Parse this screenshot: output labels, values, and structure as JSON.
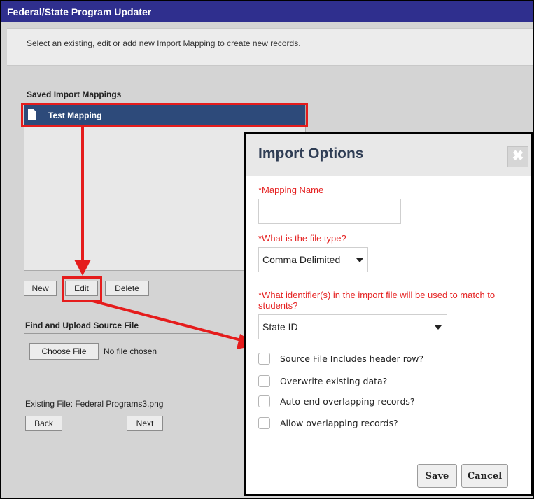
{
  "window": {
    "title": "Federal/State Program Updater"
  },
  "instructions": "Select an existing, edit or add new Import Mapping to create new records.",
  "saved_mappings": {
    "label": "Saved Import Mappings",
    "items": [
      {
        "label": "Test Mapping",
        "icon": "document-icon",
        "selected": true
      }
    ]
  },
  "mapping_buttons": {
    "new": "New",
    "edit": "Edit",
    "delete": "Delete"
  },
  "upload": {
    "label": "Find and Upload Source File",
    "choose_button": "Choose File",
    "status": "No file chosen",
    "existing_file": "Existing File: Federal Programs3.png"
  },
  "nav_buttons": {
    "back": "Back",
    "next": "Next"
  },
  "dialog": {
    "title": "Import Options",
    "close_glyph": "✖",
    "mapping_name_label": "*Mapping Name",
    "mapping_name_value": "",
    "file_type_label": "*What is the file type?",
    "file_type_value": "Comma Delimited",
    "identifier_label": "*What identifier(s) in the import file will be used to match to students?",
    "identifier_value": "State ID",
    "options": [
      {
        "label": "Source File Includes header row?",
        "checked": false
      },
      {
        "label": "Overwrite existing data?",
        "checked": false
      },
      {
        "label": "Auto-end overlapping records?",
        "checked": false
      },
      {
        "label": "Allow overlapping records?",
        "checked": false
      }
    ],
    "save": "Save",
    "cancel": "Cancel"
  },
  "colors": {
    "title_bar": "#2f2f8e",
    "selected_item": "#2d4a7a",
    "callout_red": "#e51c1c",
    "required_label": "#e52222"
  }
}
